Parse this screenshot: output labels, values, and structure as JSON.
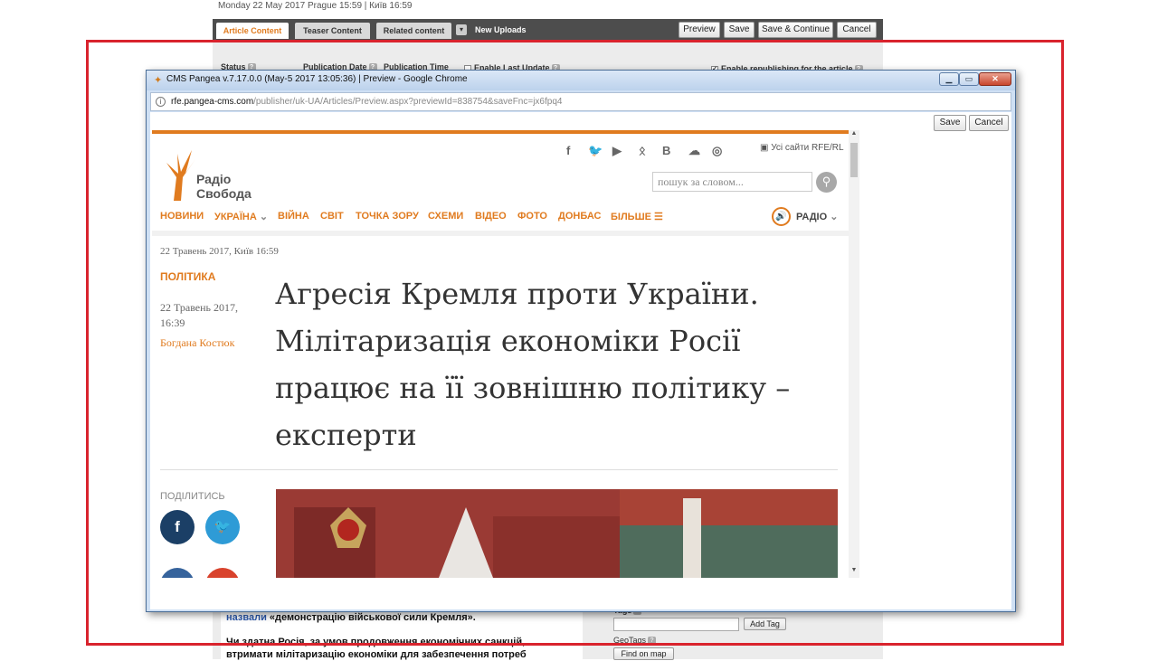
{
  "cms": {
    "date_line": "Monday 22 May 2017 Prague 15:59 | Київ 16:59",
    "tabs": [
      "Article Content",
      "Teaser Content",
      "Related content"
    ],
    "new_uploads": "New Uploads",
    "buttons": {
      "preview": "Preview",
      "save": "Save",
      "save_continue": "Save & Continue",
      "cancel": "Cancel"
    },
    "fields": {
      "status": "Status",
      "publication_date": "Publication Date",
      "publication_time": "Publication Time",
      "enable_last_update": "Enable Last Update",
      "enable_republishing": "Enable republishing for the article"
    },
    "body_link": "назвали",
    "body_line1": " «демонстрацію військової сили Кремля».",
    "body_line2": "Чи здатна Росія, за умов продовження економічних санкцій,",
    "body_line3": "втримати мілітаризацію економіки для забезпечення потреб",
    "tags_label": "Tags",
    "add_tag": "Add Tag",
    "geotags_label": "GeoTags",
    "find_on_map": "Find on map"
  },
  "popup": {
    "title": "CMS Pangea v.7.17.0.0 (May-5 2017 13:05:36) | Preview - Google Chrome",
    "url_host": "rfe.pangea-cms.com",
    "url_path": "/publisher/uk-UA/Articles/Preview.aspx?previewId=838754&saveFnc=jx6fpq4",
    "save": "Save",
    "cancel": "Cancel"
  },
  "site": {
    "logo_line1": "Радіо",
    "logo_line2": "Свобода",
    "social_icons": [
      "facebook-icon",
      "twitter-icon",
      "youtube-icon",
      "odnoklassniki-icon",
      "vk-icon",
      "soundcloud-icon",
      "instagram-icon"
    ],
    "all_sites": "Усі сайти RFE/RL",
    "search_placeholder": "пошук за словом...",
    "nav": [
      "НОВИНИ",
      "УКРАЇНА",
      "ВІЙНА",
      "СВІТ",
      "ТОЧКА ЗОРУ",
      "СХЕМИ",
      "ВІДЕО",
      "ФОТО",
      "ДОНБАС",
      "БІЛЬШЕ"
    ],
    "radio": "РАДІО"
  },
  "article": {
    "dateline": "22 Травень 2017, Київ 16:59",
    "category": "ПОЛІТИКА",
    "meta_date": "22 Травень 2017, 16:39",
    "author": "Богдана Костюк",
    "headline": "Агресія Кремля проти України. Мілітаризація економіки Росії працює на її зовнішню політику – експерти",
    "share_label": "ПОДІЛИТИСЬ"
  },
  "colors": {
    "accent": "#e07b1f",
    "annotation_red": "#d9232d",
    "facebook": "#1b3f66",
    "twitter": "#2e9bd6"
  }
}
